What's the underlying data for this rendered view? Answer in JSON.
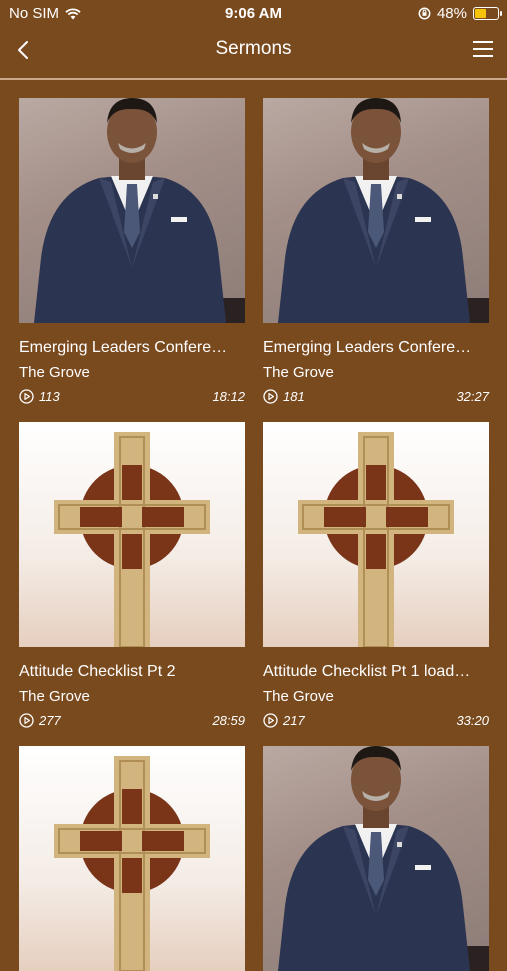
{
  "status": {
    "carrier": "No SIM",
    "time": "9:06 AM",
    "battery": "48%",
    "battery_level": 0.48
  },
  "nav": {
    "title": "Sermons",
    "back_icon": "chevron-left-icon",
    "menu_icon": "hamburger-menu-icon"
  },
  "colors": {
    "background": "#7a4a1f",
    "divider": "#c9a98a",
    "battery": "#f6c40a"
  },
  "sermons": [
    {
      "title": "Emerging Leaders Confere…",
      "subtitle": "The Grove",
      "plays": "113",
      "duration": "18:12",
      "thumb": "portrait"
    },
    {
      "title": "Emerging Leaders Confere…",
      "subtitle": "The Grove",
      "plays": "181",
      "duration": "32:27",
      "thumb": "portrait"
    },
    {
      "title": "Attitude Checklist Pt 2",
      "subtitle": "The Grove",
      "plays": "277",
      "duration": "28:59",
      "thumb": "cross"
    },
    {
      "title": "Attitude Checklist Pt 1 load…",
      "subtitle": "The Grove",
      "plays": "217",
      "duration": "33:20",
      "thumb": "cross"
    },
    {
      "title": "",
      "subtitle": "",
      "plays": "",
      "duration": "",
      "thumb": "cross"
    },
    {
      "title": "",
      "subtitle": "",
      "plays": "",
      "duration": "",
      "thumb": "portrait"
    }
  ]
}
